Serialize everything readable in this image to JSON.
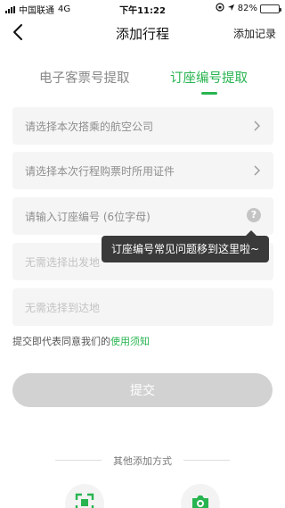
{
  "status_bar": {
    "carrier": "中国联通",
    "network": "4G",
    "time": "下午11:22",
    "battery": "82%",
    "battery_level": 0.82
  },
  "nav": {
    "title": "添加行程",
    "action_label": "添加记录",
    "back_icon": "chevron-left-icon"
  },
  "tabs": [
    {
      "label": "电子客票号提取",
      "active": false
    },
    {
      "label": "订座编号提取",
      "active": true
    }
  ],
  "form": {
    "airline_placeholder": "请选择本次搭乘的航空公司",
    "id_placeholder": "请选择本次行程购票时所用证件",
    "booking_placeholder": "请输入订座编号 (6位字母)",
    "origin_placeholder": "无需选择出发地",
    "destination_placeholder": "无需选择到达地",
    "help_label": "?"
  },
  "tooltip": {
    "text": "订座编号常见问题移到这里啦~"
  },
  "agreement": {
    "prefix": "提交即代表同意我们的",
    "link": "使用须知"
  },
  "submit_label": "提交",
  "other_methods": {
    "title": "其他添加方式",
    "items": [
      "scan-icon",
      "camera-icon"
    ]
  },
  "colors": {
    "accent": "#28b450",
    "disabled_button": "#d2d2d2",
    "field_bg": "#f5f5f5"
  }
}
